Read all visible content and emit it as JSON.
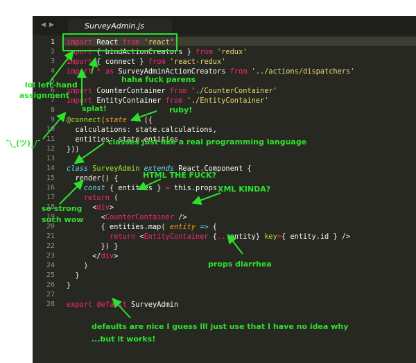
{
  "tab": {
    "filename": "SurveyAdmin.js"
  },
  "nav": {
    "back": "◀",
    "forward": "▶"
  },
  "gutter": {
    "line_numbers": [
      "1",
      "2",
      "3",
      "4",
      "5",
      "6",
      "7",
      "8",
      "9",
      "10",
      "11",
      "12",
      "13",
      "14",
      "15",
      "16",
      "17",
      "18",
      "19",
      "20",
      "21",
      "22",
      "23",
      "24",
      "25",
      "26",
      "27",
      "28"
    ]
  },
  "code": {
    "l1": [
      "import",
      " React ",
      "from",
      " 'react'"
    ],
    "l2": [
      "import",
      " { bindActionCreators } ",
      "from",
      " 'redux'"
    ],
    "l3": [
      "import",
      " { connect } ",
      "from",
      " 'react-redux'"
    ],
    "l4": [
      "import",
      " * ",
      "as",
      " SurveyAdminActionCreators ",
      "from",
      " '../actions/dispatchers'"
    ],
    "l6": [
      "import",
      " CounterContainer ",
      "from",
      " './CounterContainer'"
    ],
    "l7": [
      "import",
      " EntityContainer ",
      "from",
      " './EntityContainer'"
    ],
    "l9": [
      "@connect(",
      "state",
      " ",
      "=>",
      " ({"
    ],
    "l10": [
      "  calculations: state.calculations,"
    ],
    "l11": [
      "  entities: state.entities"
    ],
    "l12": [
      "}))"
    ],
    "l14": [
      "class",
      " ",
      "SurveyAdmin",
      " ",
      "extends",
      " React.Component {"
    ],
    "l15": [
      "  ",
      "render",
      "() {"
    ],
    "l16": [
      "    ",
      "const",
      " { entities } ",
      "=",
      " ",
      "this",
      ".props"
    ],
    "l17": [
      "    ",
      "return",
      " ("
    ],
    "l18": [
      "      <",
      "div",
      ">"
    ],
    "l19": [
      "        <",
      "CounterContainer",
      " />"
    ],
    "l20": [
      "        { entities.map( ",
      "entity",
      " ",
      "=>",
      " {"
    ],
    "l21": [
      "          ",
      "return",
      " <",
      "EntityContainer",
      " {",
      "...",
      "entity} ",
      "key",
      "=",
      "{ entity.id }",
      " />"
    ],
    "l22": [
      "        }) }"
    ],
    "l23": [
      "      </",
      "div",
      ">"
    ],
    "l24": [
      "    )"
    ],
    "l25": [
      "  }"
    ],
    "l26": [
      "}"
    ],
    "l28": [
      "export",
      " ",
      "default",
      " SurveyAdmin"
    ]
  },
  "annotations": {
    "lol_lefthand": "lol left-hand",
    "assignment": "assignment",
    "haha": "haha fuck parens",
    "splat": "splat!",
    "ruby": "ruby!",
    "shrug": "¯\\_(ツ)_/¯",
    "classes": "classes just like a real programming language",
    "html": "HTML THE FUCK?",
    "xml": "XML KINDA?",
    "so_strong": "so strong",
    "such_wow": "such wow",
    "props": "props diarrhea",
    "defaults_1": "defaults are nice I guess lll just use that I have no idea why",
    "defaults_2": "...but it works!"
  },
  "colors": {
    "annotation_green": "#2ee02e",
    "editor_bg": "#272822",
    "keyword": "#f92672",
    "string": "#e6db74",
    "storage": "#66d9ef",
    "entity": "#a6e22e",
    "param": "#fd971f"
  }
}
